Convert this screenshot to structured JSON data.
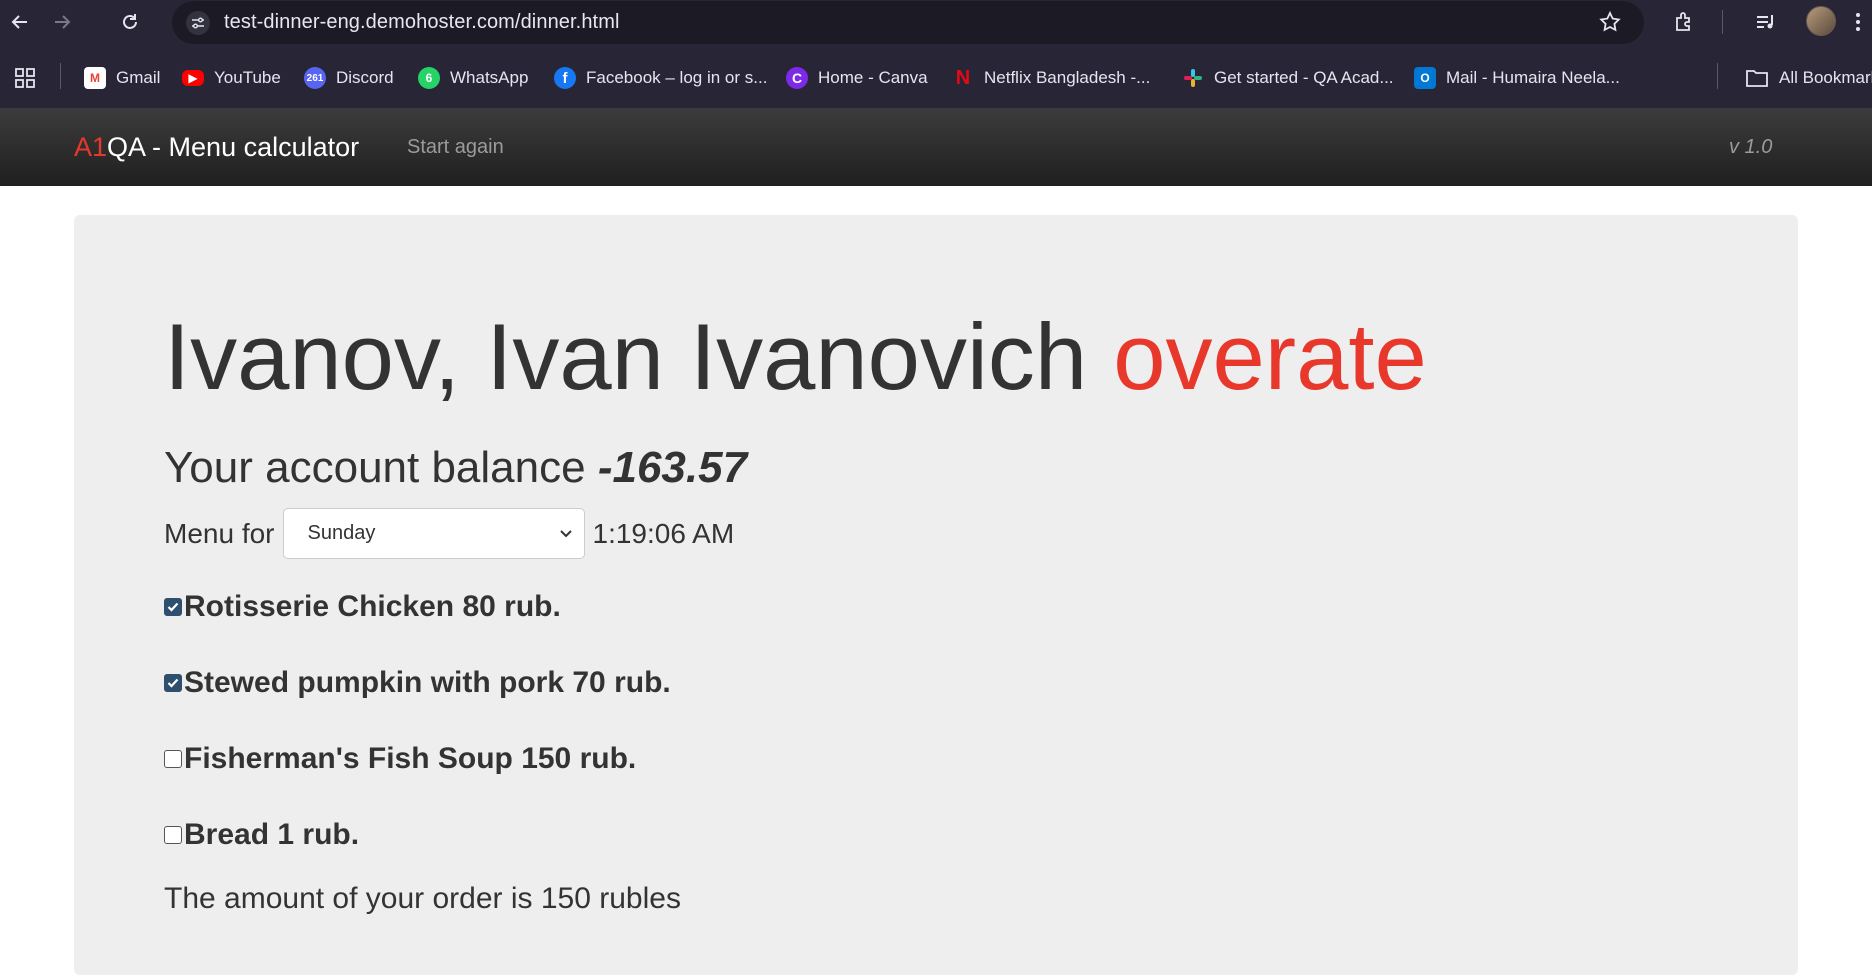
{
  "browser": {
    "url": "test-dinner-eng.demohoster.com/dinner.html",
    "bookmarks": [
      {
        "label": "Gmail",
        "icon": "gmail-icon",
        "color": "#ea4335"
      },
      {
        "label": "YouTube",
        "icon": "youtube-icon",
        "color": "#ff0000"
      },
      {
        "label": "Discord",
        "icon": "discord-icon",
        "color": "#5865f2",
        "badge": "261"
      },
      {
        "label": "WhatsApp",
        "icon": "whatsapp-icon",
        "color": "#25d366",
        "badge": "6"
      },
      {
        "label": "Facebook – log in or s...",
        "icon": "facebook-icon",
        "color": "#1877f2"
      },
      {
        "label": "Home - Canva",
        "icon": "canva-icon",
        "color": "#7d2ae8"
      },
      {
        "label": "Netflix Bangladesh -...",
        "icon": "netflix-icon",
        "color": "#e50914"
      },
      {
        "label": "Get started - QA Acad...",
        "icon": "slack-icon",
        "color": "#e01e5a"
      },
      {
        "label": "Mail - Humaira Neela...",
        "icon": "outlook-icon",
        "color": "#0078d4"
      }
    ],
    "all_bookmarks": "All Bookmarks"
  },
  "navbar": {
    "brand_accent": "A1",
    "brand_rest": "QA - Menu calculator",
    "start_again": "Start again",
    "version": "v 1.0"
  },
  "main": {
    "name": "Ivanov, Ivan Ivanovich",
    "status": "overate",
    "balance_label": "Your account balance",
    "balance_value": "-163.57",
    "menu_for_label": "Menu for",
    "day_selected": "Sunday",
    "time": "1:19:06 AM",
    "dishes": [
      {
        "label": "Rotisserie Chicken 80 rub.",
        "checked": true
      },
      {
        "label": "Stewed pumpkin with pork 70 rub.",
        "checked": true
      },
      {
        "label": "Fisherman's Fish Soup 150 rub.",
        "checked": false
      },
      {
        "label": "Bread 1 rub.",
        "checked": false
      }
    ],
    "total_text": "The amount of your order is 150 rubles"
  }
}
